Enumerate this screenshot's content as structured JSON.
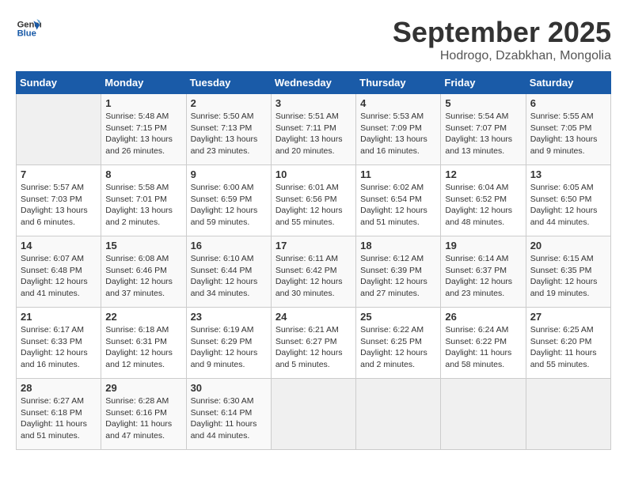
{
  "header": {
    "logo_line1": "General",
    "logo_line2": "Blue",
    "month_title": "September 2025",
    "location": "Hodrogo, Dzabkhan, Mongolia"
  },
  "days_of_week": [
    "Sunday",
    "Monday",
    "Tuesday",
    "Wednesday",
    "Thursday",
    "Friday",
    "Saturday"
  ],
  "weeks": [
    [
      {
        "day": "",
        "info": ""
      },
      {
        "day": "1",
        "info": "Sunrise: 5:48 AM\nSunset: 7:15 PM\nDaylight: 13 hours\nand 26 minutes."
      },
      {
        "day": "2",
        "info": "Sunrise: 5:50 AM\nSunset: 7:13 PM\nDaylight: 13 hours\nand 23 minutes."
      },
      {
        "day": "3",
        "info": "Sunrise: 5:51 AM\nSunset: 7:11 PM\nDaylight: 13 hours\nand 20 minutes."
      },
      {
        "day": "4",
        "info": "Sunrise: 5:53 AM\nSunset: 7:09 PM\nDaylight: 13 hours\nand 16 minutes."
      },
      {
        "day": "5",
        "info": "Sunrise: 5:54 AM\nSunset: 7:07 PM\nDaylight: 13 hours\nand 13 minutes."
      },
      {
        "day": "6",
        "info": "Sunrise: 5:55 AM\nSunset: 7:05 PM\nDaylight: 13 hours\nand 9 minutes."
      }
    ],
    [
      {
        "day": "7",
        "info": "Sunrise: 5:57 AM\nSunset: 7:03 PM\nDaylight: 13 hours\nand 6 minutes."
      },
      {
        "day": "8",
        "info": "Sunrise: 5:58 AM\nSunset: 7:01 PM\nDaylight: 13 hours\nand 2 minutes."
      },
      {
        "day": "9",
        "info": "Sunrise: 6:00 AM\nSunset: 6:59 PM\nDaylight: 12 hours\nand 59 minutes."
      },
      {
        "day": "10",
        "info": "Sunrise: 6:01 AM\nSunset: 6:56 PM\nDaylight: 12 hours\nand 55 minutes."
      },
      {
        "day": "11",
        "info": "Sunrise: 6:02 AM\nSunset: 6:54 PM\nDaylight: 12 hours\nand 51 minutes."
      },
      {
        "day": "12",
        "info": "Sunrise: 6:04 AM\nSunset: 6:52 PM\nDaylight: 12 hours\nand 48 minutes."
      },
      {
        "day": "13",
        "info": "Sunrise: 6:05 AM\nSunset: 6:50 PM\nDaylight: 12 hours\nand 44 minutes."
      }
    ],
    [
      {
        "day": "14",
        "info": "Sunrise: 6:07 AM\nSunset: 6:48 PM\nDaylight: 12 hours\nand 41 minutes."
      },
      {
        "day": "15",
        "info": "Sunrise: 6:08 AM\nSunset: 6:46 PM\nDaylight: 12 hours\nand 37 minutes."
      },
      {
        "day": "16",
        "info": "Sunrise: 6:10 AM\nSunset: 6:44 PM\nDaylight: 12 hours\nand 34 minutes."
      },
      {
        "day": "17",
        "info": "Sunrise: 6:11 AM\nSunset: 6:42 PM\nDaylight: 12 hours\nand 30 minutes."
      },
      {
        "day": "18",
        "info": "Sunrise: 6:12 AM\nSunset: 6:39 PM\nDaylight: 12 hours\nand 27 minutes."
      },
      {
        "day": "19",
        "info": "Sunrise: 6:14 AM\nSunset: 6:37 PM\nDaylight: 12 hours\nand 23 minutes."
      },
      {
        "day": "20",
        "info": "Sunrise: 6:15 AM\nSunset: 6:35 PM\nDaylight: 12 hours\nand 19 minutes."
      }
    ],
    [
      {
        "day": "21",
        "info": "Sunrise: 6:17 AM\nSunset: 6:33 PM\nDaylight: 12 hours\nand 16 minutes."
      },
      {
        "day": "22",
        "info": "Sunrise: 6:18 AM\nSunset: 6:31 PM\nDaylight: 12 hours\nand 12 minutes."
      },
      {
        "day": "23",
        "info": "Sunrise: 6:19 AM\nSunset: 6:29 PM\nDaylight: 12 hours\nand 9 minutes."
      },
      {
        "day": "24",
        "info": "Sunrise: 6:21 AM\nSunset: 6:27 PM\nDaylight: 12 hours\nand 5 minutes."
      },
      {
        "day": "25",
        "info": "Sunrise: 6:22 AM\nSunset: 6:25 PM\nDaylight: 12 hours\nand 2 minutes."
      },
      {
        "day": "26",
        "info": "Sunrise: 6:24 AM\nSunset: 6:22 PM\nDaylight: 11 hours\nand 58 minutes."
      },
      {
        "day": "27",
        "info": "Sunrise: 6:25 AM\nSunset: 6:20 PM\nDaylight: 11 hours\nand 55 minutes."
      }
    ],
    [
      {
        "day": "28",
        "info": "Sunrise: 6:27 AM\nSunset: 6:18 PM\nDaylight: 11 hours\nand 51 minutes."
      },
      {
        "day": "29",
        "info": "Sunrise: 6:28 AM\nSunset: 6:16 PM\nDaylight: 11 hours\nand 47 minutes."
      },
      {
        "day": "30",
        "info": "Sunrise: 6:30 AM\nSunset: 6:14 PM\nDaylight: 11 hours\nand 44 minutes."
      },
      {
        "day": "",
        "info": ""
      },
      {
        "day": "",
        "info": ""
      },
      {
        "day": "",
        "info": ""
      },
      {
        "day": "",
        "info": ""
      }
    ]
  ]
}
